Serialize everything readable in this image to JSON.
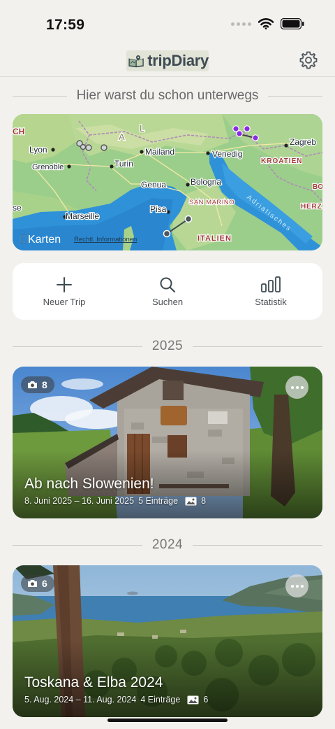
{
  "status_bar": {
    "time": "17:59"
  },
  "navbar": {
    "logo_text": "tripDiary"
  },
  "intro": {
    "heading": "Hier warst du schon unterwegs"
  },
  "map": {
    "places": [
      "CH",
      "Lyon",
      "Grenoble",
      "Mailand",
      "Turin",
      "Genua",
      "Venedig",
      "Bologna",
      "Marseille",
      "Pisa",
      "Zagreb",
      "KROATIEN",
      "SAN MARINO",
      "ITALIEN",
      "BO",
      "HERZ",
      "se",
      "A",
      "L"
    ],
    "sea_label": "Adriatisches",
    "attribution": "Karten",
    "legal": "Rechtl. Informationen"
  },
  "actions": [
    {
      "label": "Neuer Trip",
      "icon": "plus-icon"
    },
    {
      "label": "Suchen",
      "icon": "search-icon"
    },
    {
      "label": "Statistik",
      "icon": "bar-chart-icon"
    }
  ],
  "years": [
    "2025",
    "2024"
  ],
  "trips": [
    {
      "title": "Ab nach Slowenien!",
      "dates": "8. Juni 2025 – 16. Juni 2025",
      "entries": "5 Einträge",
      "photos": "8",
      "photo_badge": "8"
    },
    {
      "title": "Toskana & Elba 2024",
      "dates": "5. Aug. 2024 – 11. Aug. 2024",
      "entries": "4 Einträge",
      "photos": "6",
      "photo_badge": "6"
    }
  ],
  "colors": {
    "background": "#f2f1ee",
    "accent": "#3d4b52",
    "map_route": "#8a2be2"
  }
}
